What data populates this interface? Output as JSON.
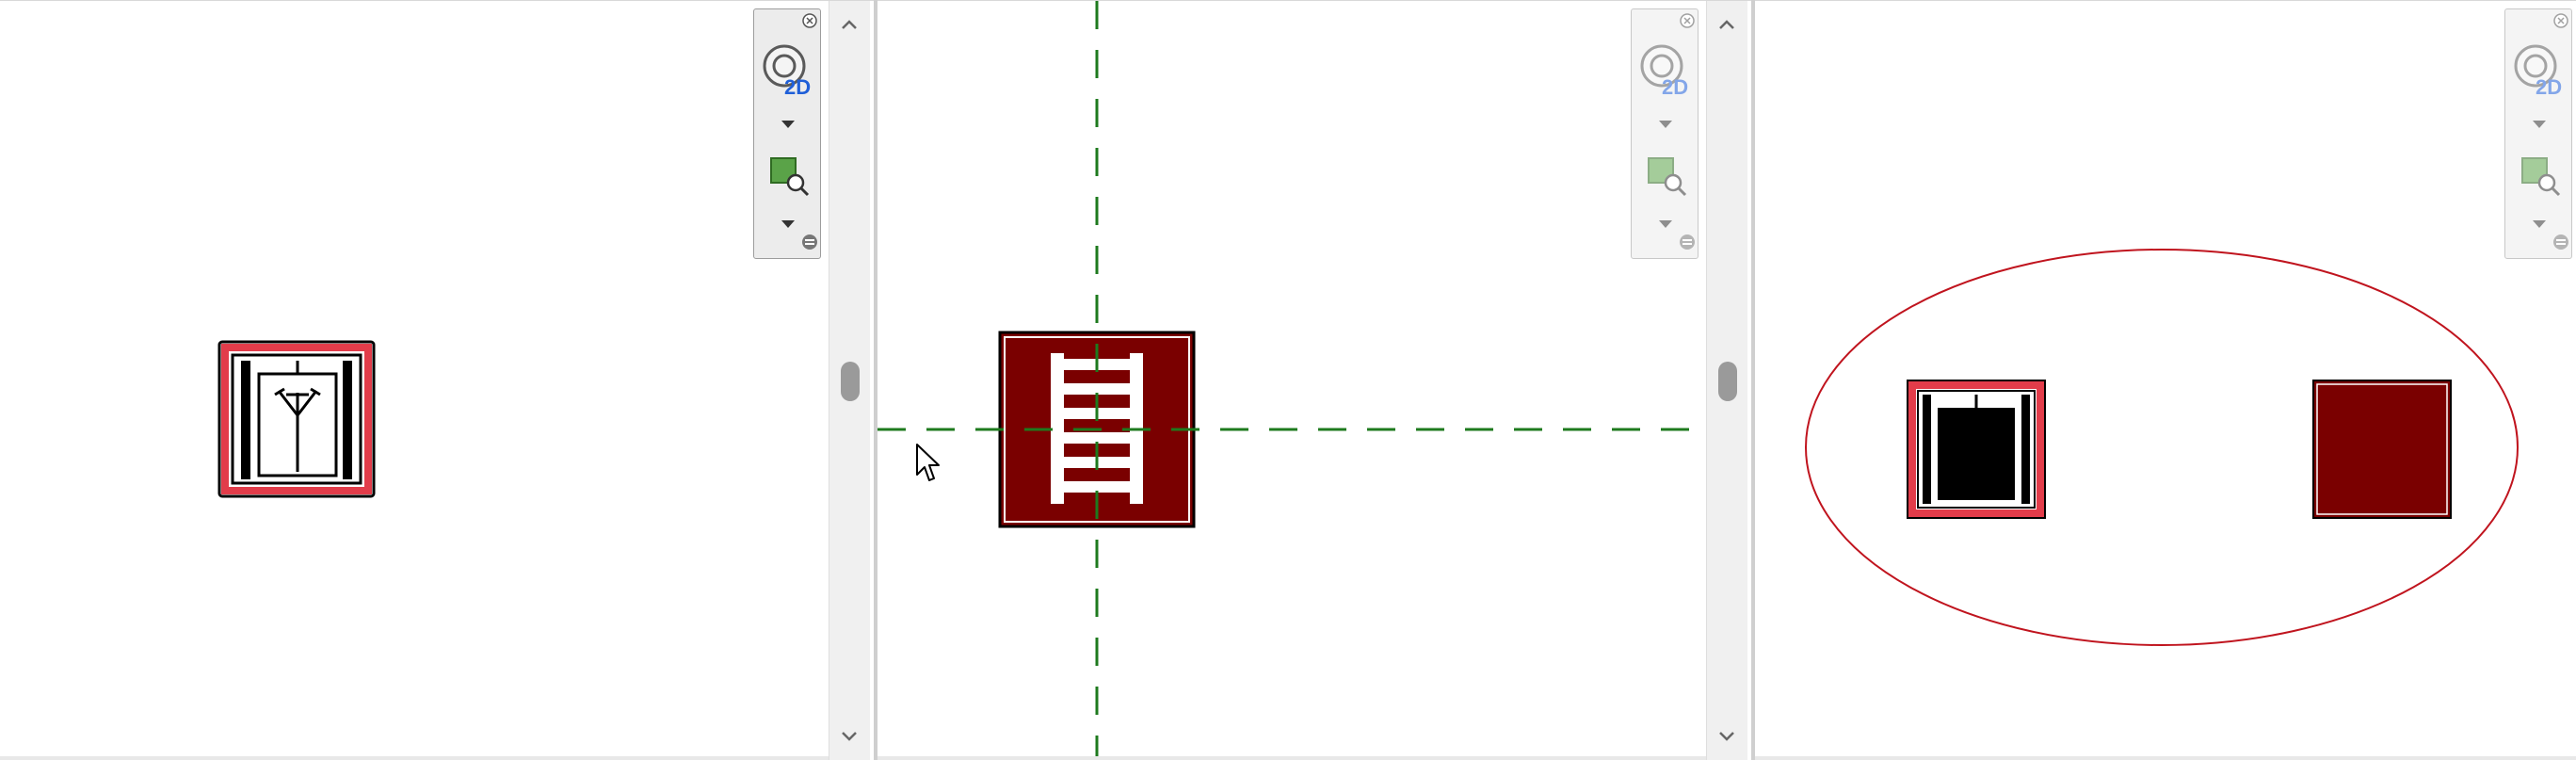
{
  "window": {
    "views": [
      {
        "id": "view-1",
        "symbol": "elevator-symbol",
        "scroll": "vertical-scrollbar"
      },
      {
        "id": "view-2",
        "symbol": "ladder-symbol",
        "scroll": "vertical-scrollbar"
      },
      {
        "id": "view-3",
        "symbol": "elevator-symbol-and-filled-square",
        "scroll": "vertical-scrollbar"
      }
    ]
  },
  "navigation_bar": {
    "wheel_label": "2D",
    "buttons": [
      "close",
      "2d-steering-wheel",
      "steering-wheel-dropdown",
      "zoom-region",
      "zoom-dropdown",
      "options"
    ]
  },
  "colors": {
    "symbol_outline_red": "#e23c4a",
    "symbol_fill_dark_red": "#7a0000",
    "crosshair_green": "#1e7a1e",
    "cloud_red": "#c0141e",
    "wheel_2d_blue": "#1f5fd8",
    "zoom_green": "#5aa348"
  }
}
